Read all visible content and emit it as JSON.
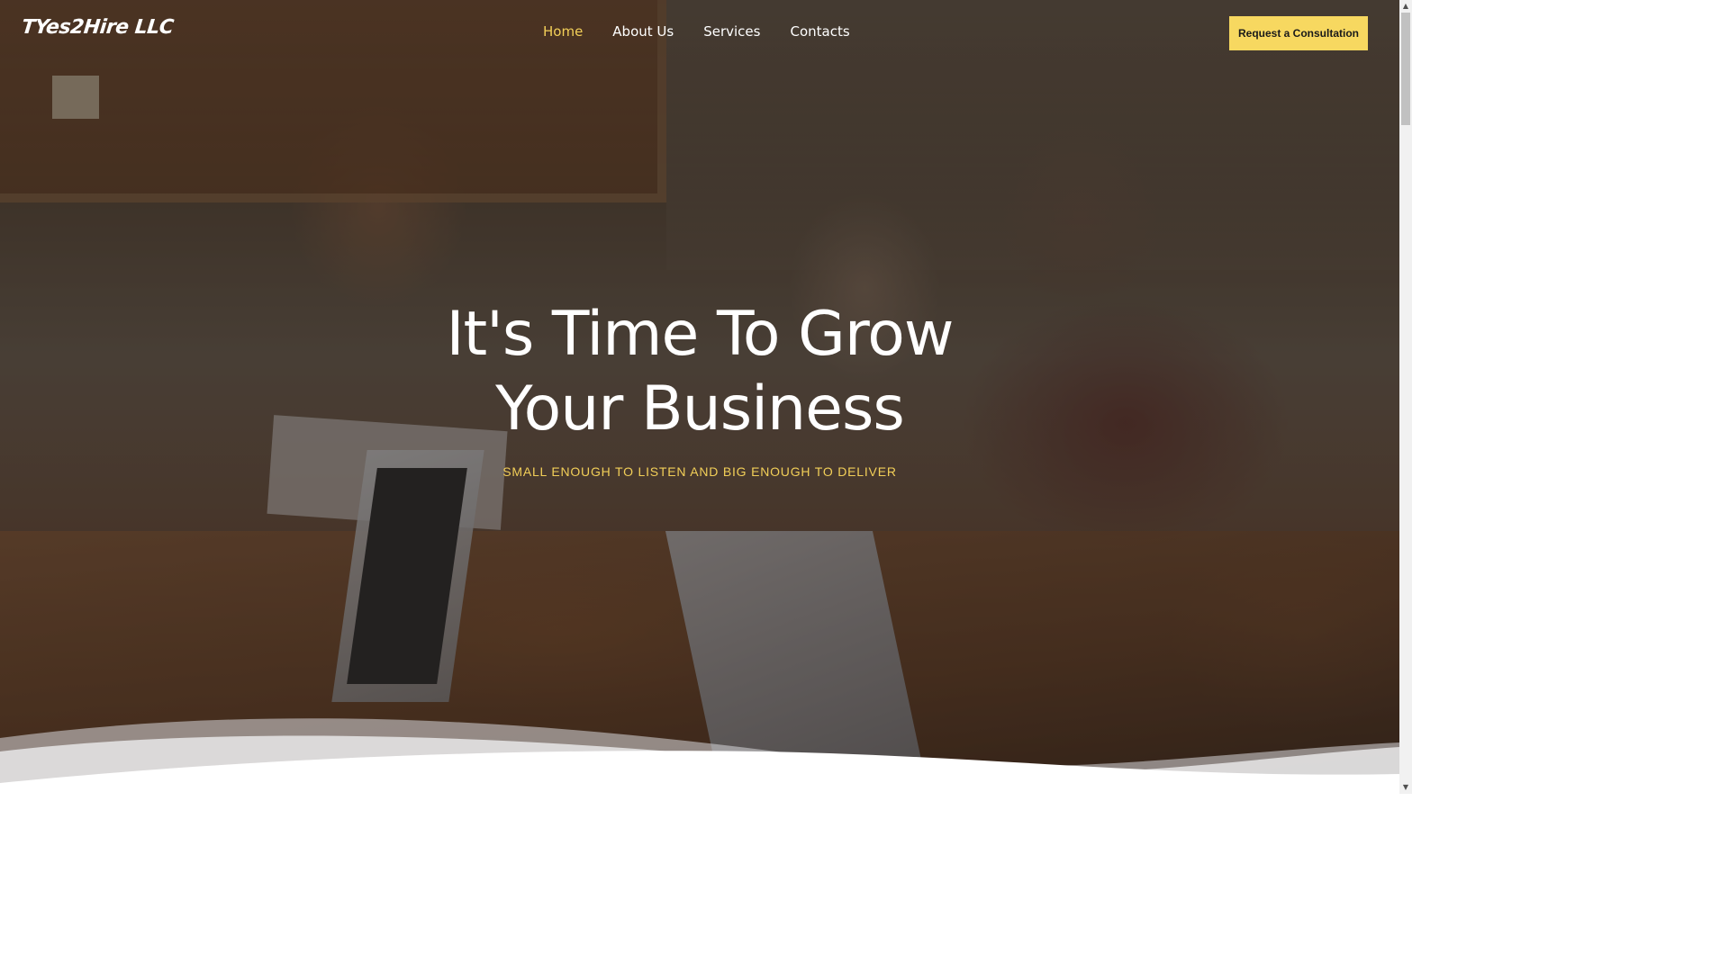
{
  "header": {
    "logo_text": "TYes2Hire LLC",
    "nav": [
      {
        "label": "Home",
        "active": true
      },
      {
        "label": "About Us",
        "active": false
      },
      {
        "label": "Services",
        "active": false
      },
      {
        "label": "Contacts",
        "active": false
      }
    ],
    "cta_label": "Request a Consultation"
  },
  "hero": {
    "title_line1": "It's Time To Grow",
    "title_line2": "Your Business",
    "subtitle": "SMALL ENOUGH TO LISTEN AND BIG ENOUGH TO DELIVER"
  },
  "scrollbar": {
    "up_icon": "chevron-up-icon",
    "down_icon": "chevron-down-icon"
  },
  "colors": {
    "accent": "#f7d860",
    "active_nav": "#f2cf58",
    "text": "#ffffff"
  }
}
